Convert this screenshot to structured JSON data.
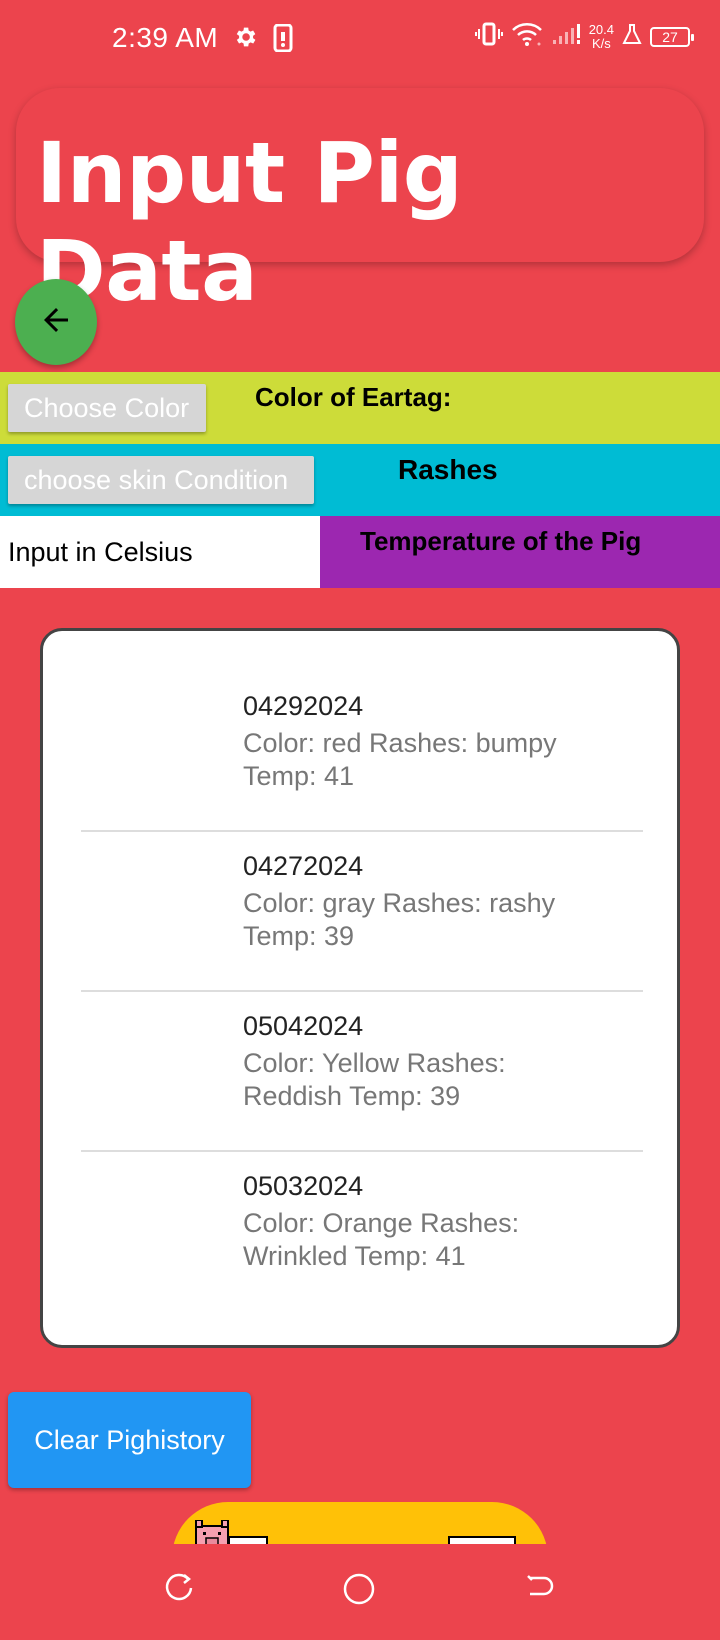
{
  "status_bar": {
    "time": "2:39 AM",
    "speed_top": "20.4",
    "speed_bottom": "K/s",
    "battery": "27"
  },
  "header": {
    "title": "Input Pig Data"
  },
  "form": {
    "color_button": "Choose Color",
    "color_label": "Color of Eartag:",
    "skin_button": "choose skin Condition",
    "rashes_label": "Rashes",
    "temp_placeholder": "Input in Celsius",
    "temp_label": "Temperature of the Pig"
  },
  "history": [
    {
      "id": "04292024",
      "detail": " Color: red  Rashes: bumpy Temp: 41"
    },
    {
      "id": "04272024",
      "detail": " Color: gray  Rashes: rashy Temp: 39"
    },
    {
      "id": "05042024",
      "detail": " Color: Yellow  Rashes: Reddish Temp: 39"
    },
    {
      "id": "05032024",
      "detail": " Color: Orange  Rashes: Wrinkled Temp: 41"
    }
  ],
  "actions": {
    "clear_label": "Clear Pighistory"
  },
  "colors": {
    "background": "#EC444D",
    "eartag_row": "#CDDC39",
    "rashes_row": "#00BCD4",
    "temp_label_bg": "#9C27B0",
    "back_fab": "#4CAF50",
    "clear_button": "#2196F3",
    "banner": "#FFC107"
  },
  "icons": [
    "gear-icon",
    "phone-icon",
    "vibrate-icon",
    "wifi-icon",
    "signal-icon",
    "lab-icon",
    "battery-icon",
    "arrow-back-icon",
    "pig-icon",
    "nav-recent-icon",
    "nav-home-icon",
    "nav-back-icon"
  ]
}
